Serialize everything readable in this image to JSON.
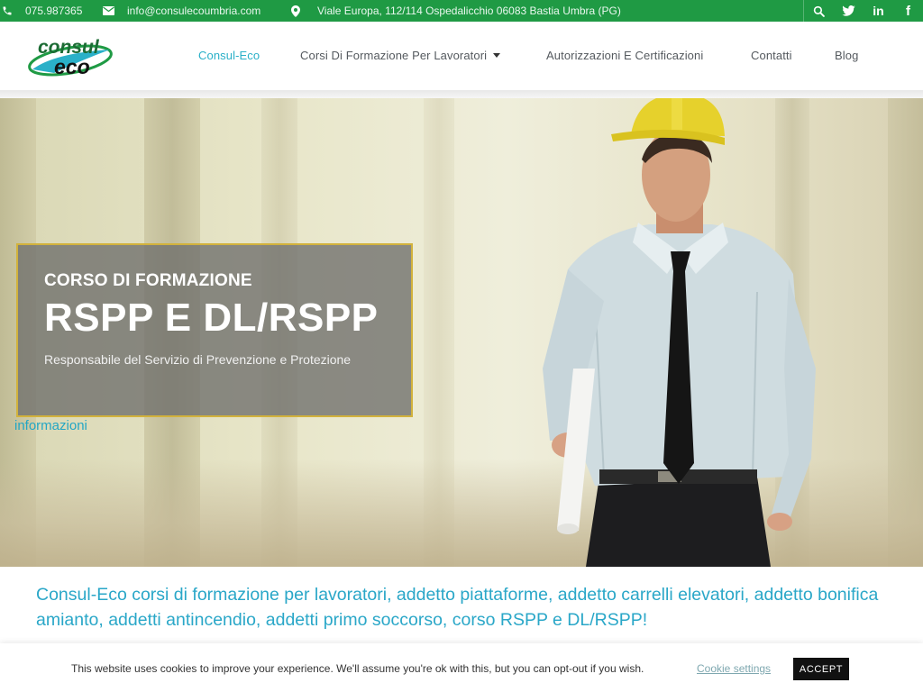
{
  "topbar": {
    "phone": "075.987365",
    "email": "info@consulecoumbria.com",
    "address": "Viale Europa, 112/114 Ospedalicchio 06083 Bastia Umbra (PG)",
    "icons": [
      "phone-icon",
      "envelope-icon",
      "map-pin-icon",
      "search-icon",
      "twitter-icon",
      "linkedin-icon",
      "facebook-icon"
    ],
    "social": {
      "linkedin": "in",
      "facebook": "f"
    },
    "colors": {
      "background": "#1f9a44"
    }
  },
  "logo": {
    "line1": "consul",
    "line2": "eco"
  },
  "nav": {
    "items": [
      {
        "label": "Consul-Eco",
        "active": true
      },
      {
        "label": "Corsi Di Formazione Per Lavoratori",
        "has_dropdown": true
      },
      {
        "label": "Autorizzazioni E Certificazioni"
      },
      {
        "label": "Contatti"
      },
      {
        "label": "Blog"
      }
    ],
    "colors": {
      "active": "#2ab0c8",
      "default": "#555a5f"
    }
  },
  "hero": {
    "kicker": "CORSO DI FORMAZIONE",
    "title": "RSPP E DL/RSPP",
    "subtitle": "Responsabile del Servizio di Prevenzione e Protezione",
    "link": "informazioni",
    "colors": {
      "box_border": "#d2b23c",
      "link": "#23a6c4"
    }
  },
  "intro": {
    "text": "Consul-Eco corsi di formazione per lavoratori, addetto piattaforme, addetto carrelli elevatori, addetto bonifica amianto, addetti antincendio, addetti primo soccorso, corso RSPP e DL/RSPP!",
    "color": "#2aa7c8"
  },
  "cookie": {
    "text": "This website uses cookies to improve your experience. We'll assume you're ok with this, but you can opt-out if you wish.",
    "settings_label": "Cookie settings",
    "accept_label": "ACCEPT"
  }
}
